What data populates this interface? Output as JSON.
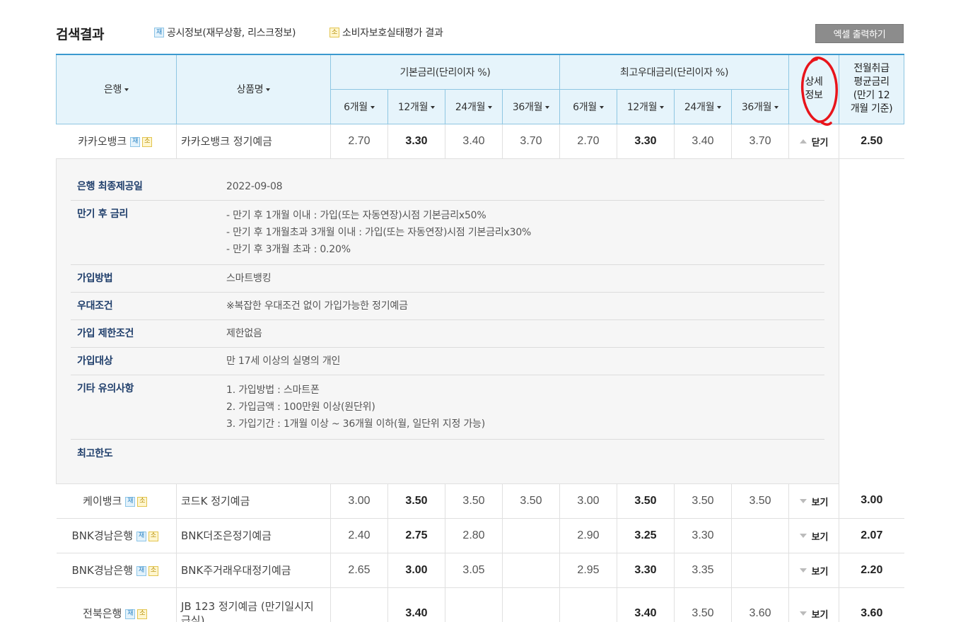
{
  "header": {
    "title": "검색결과",
    "legend_disclosure": {
      "badge": "재",
      "label": "공시정보(재무상황, 리스크정보)"
    },
    "legend_consumer": {
      "badge": "소",
      "label": "소비자보호실태평가 결과"
    },
    "excel_button": "엑셀 출력하기"
  },
  "table": {
    "headers": {
      "bank": "은행",
      "product": "상품명",
      "base_rate_group": "기본금리(단리이자 %)",
      "max_rate_group": "최고우대금리(단리이자 %)",
      "detail_line1": "상세",
      "detail_line2": "정보",
      "avg_line1": "전월취급",
      "avg_line2": "평균금리",
      "avg_line3": "(만기 12",
      "avg_line4": "개월 기준)",
      "periods": [
        "6개월",
        "12개월",
        "24개월",
        "36개월"
      ]
    },
    "rows": [
      {
        "bank": "카카오뱅크",
        "product": "카카오뱅크 정기예금",
        "base": [
          "2.70",
          "3.30",
          "3.40",
          "3.70"
        ],
        "max": [
          "2.70",
          "3.30",
          "3.40",
          "3.70"
        ],
        "toggle": "닫기",
        "avg": "2.50"
      },
      {
        "bank": "케이뱅크",
        "product": "코드K 정기예금",
        "base": [
          "3.00",
          "3.50",
          "3.50",
          "3.50"
        ],
        "max": [
          "3.00",
          "3.50",
          "3.50",
          "3.50"
        ],
        "toggle": "보기",
        "avg": "3.00"
      },
      {
        "bank": "BNK경남은행",
        "product": "BNK더조은정기예금",
        "base": [
          "2.40",
          "2.75",
          "2.80",
          ""
        ],
        "max": [
          "2.90",
          "3.25",
          "3.30",
          ""
        ],
        "toggle": "보기",
        "avg": "2.07"
      },
      {
        "bank": "BNK경남은행",
        "product": "BNK주거래우대정기예금",
        "base": [
          "2.65",
          "3.00",
          "3.05",
          ""
        ],
        "max": [
          "2.95",
          "3.30",
          "3.35",
          ""
        ],
        "toggle": "보기",
        "avg": "2.20"
      },
      {
        "bank": "전북은행",
        "product_line1": "JB 123 정기예금 (만기일시지",
        "product_line2": "급식)",
        "base": [
          "",
          "3.40",
          "",
          ""
        ],
        "max": [
          "",
          "3.40",
          "3.50",
          "3.60"
        ],
        "toggle": "보기",
        "avg": "3.60"
      }
    ],
    "badges": {
      "jae": "재",
      "so": "소"
    }
  },
  "detail": {
    "disclosure_date_label": "은행 최종제공일",
    "disclosure_date": "2022-09-08",
    "maturity_rate_label": "만기 후 금리",
    "maturity_rate_lines": [
      "- 만기 후 1개월 이내 : 가입(또는 자동연장)시점 기본금리x50%",
      "- 만기 후 1개월초과 3개월 이내 : 가입(또는 자동연장)시점 기본금리x30%",
      "- 만기 후 3개월 초과 : 0.20%"
    ],
    "join_method_label": "가입방법",
    "join_method": "스마트뱅킹",
    "preferential_label": "우대조건",
    "preferential": "※복잡한 우대조건 없이 가입가능한 정기예금",
    "restriction_label": "가입 제한조건",
    "restriction": "제한없음",
    "target_label": "가입대상",
    "target": "만 17세 이상의 실명의 개인",
    "notes_label": "기타 유의사항",
    "notes_lines": [
      "1. 가입방법 : 스마트폰",
      "2. 가입금액 : 100만원 이상(원단위)",
      "3. 가입기간 : 1개월 이상 ~ 36개월 이하(월, 일단위 지정 가능)"
    ],
    "max_limit_label": "최고한도",
    "max_limit": ""
  },
  "colors": {
    "header_bg": "#e6f4fb",
    "header_border": "#8ec6e2",
    "annotation": "#e8141b",
    "excel_btn": "#8c8c8c"
  }
}
